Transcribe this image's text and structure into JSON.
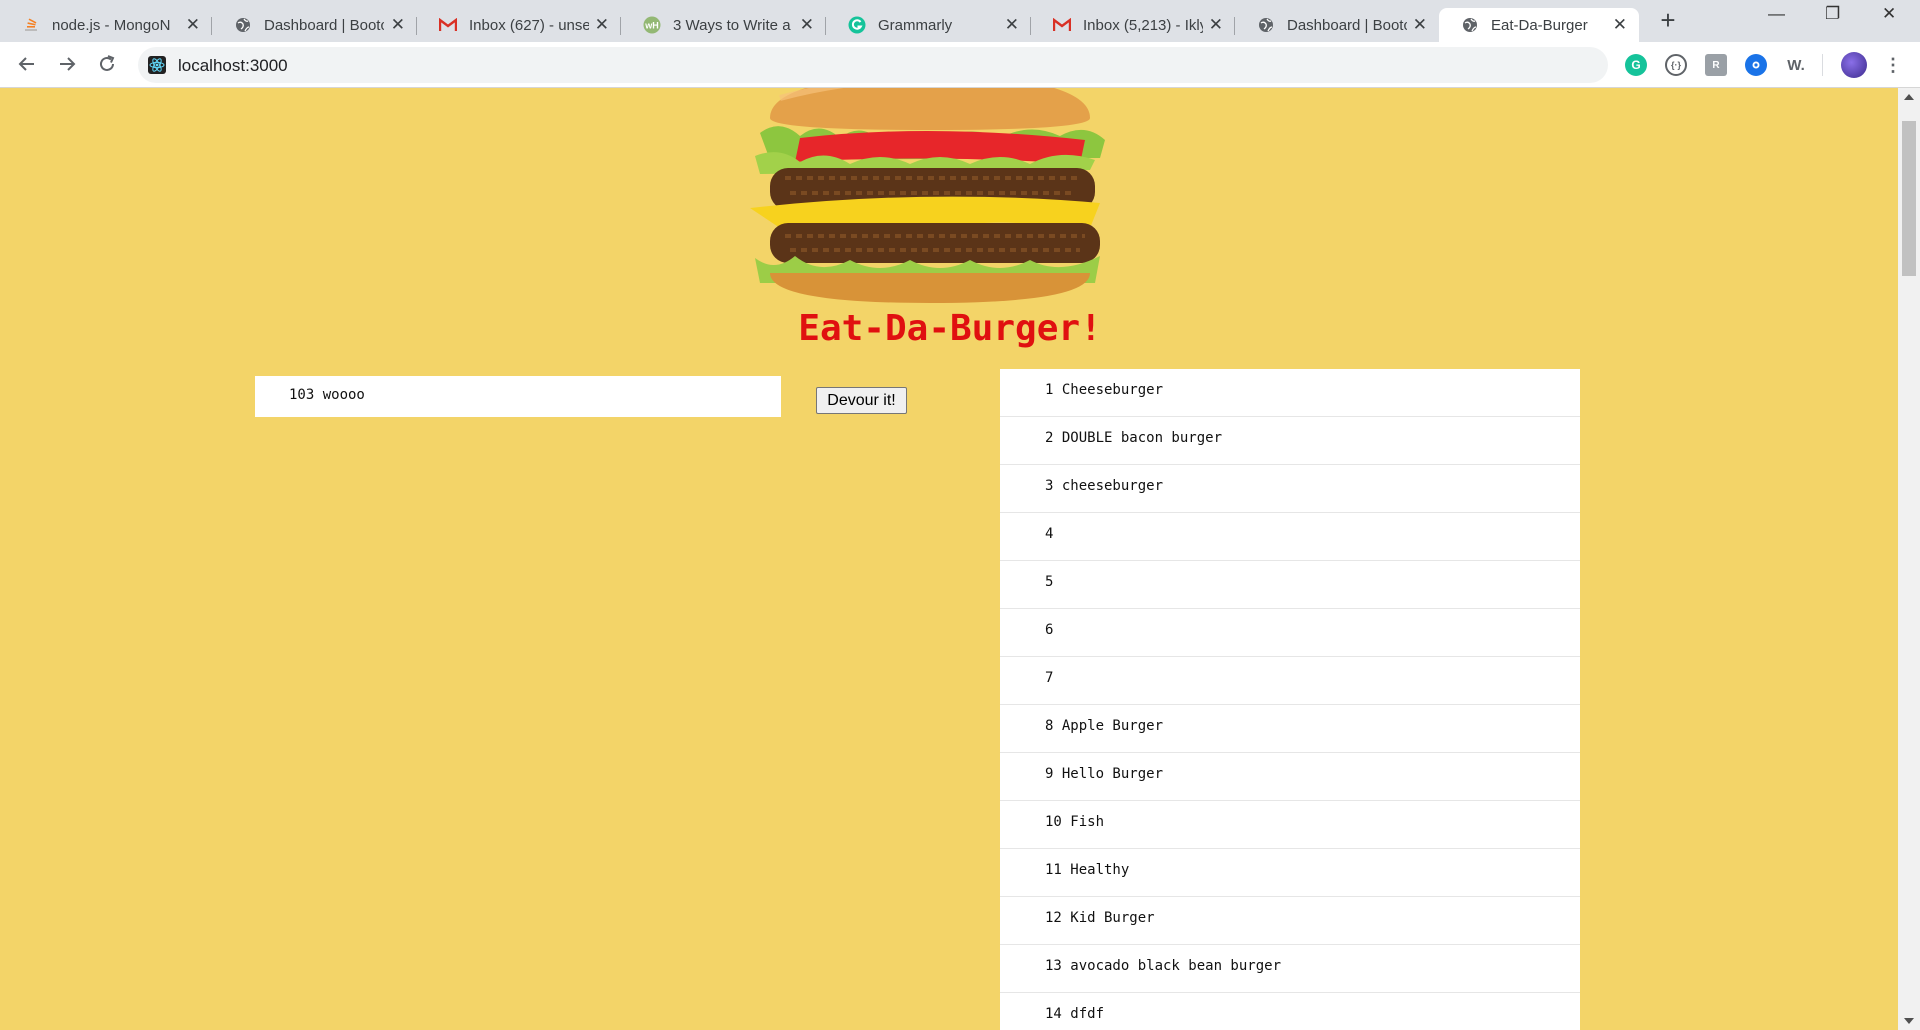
{
  "browser": {
    "tabs": [
      {
        "title": "node.js - MongoN",
        "icon": "stack-overflow-icon",
        "active": false
      },
      {
        "title": "Dashboard | Bootc",
        "icon": "globe-icon",
        "active": false
      },
      {
        "title": "Inbox (627) - unse",
        "icon": "gmail-icon",
        "active": false
      },
      {
        "title": "3 Ways to Write a",
        "icon": "wikihow-icon",
        "active": false
      },
      {
        "title": "Grammarly",
        "icon": "grammarly-icon",
        "active": false
      },
      {
        "title": "Inbox (5,213) - Ikly",
        "icon": "gmail-icon",
        "active": false
      },
      {
        "title": "Dashboard | Bootc",
        "icon": "globe-icon",
        "active": false
      },
      {
        "title": "Eat-Da-Burger",
        "icon": "globe-icon",
        "active": true
      }
    ],
    "new_tab": "+",
    "window_controls": {
      "minimize": "—",
      "restore": "❐",
      "close": "✕"
    },
    "url": "localhost:3000",
    "extensions": [
      "grammarly-icon",
      "code-icon",
      "rk-icon",
      "eye-icon",
      "wordtune-icon",
      "profile-avatar-icon"
    ]
  },
  "page": {
    "heading": "Eat-Da-Burger!",
    "form": {
      "input_value": "103 woooo"
    },
    "devour_button": "Devour it!",
    "burgers": [
      "1 Cheeseburger",
      "2 DOUBLE bacon burger",
      "3 cheeseburger",
      "4",
      "5",
      "6",
      "7",
      "8 Apple Burger",
      "9 Hello Burger",
      "10 Fish",
      "11 Healthy",
      "12 Kid Burger",
      "13 avocado black bean burger",
      "14 dfdf"
    ]
  },
  "colors": {
    "page_background": "#f3d468",
    "heading": "#e01010",
    "list_background": "#ffffff"
  }
}
